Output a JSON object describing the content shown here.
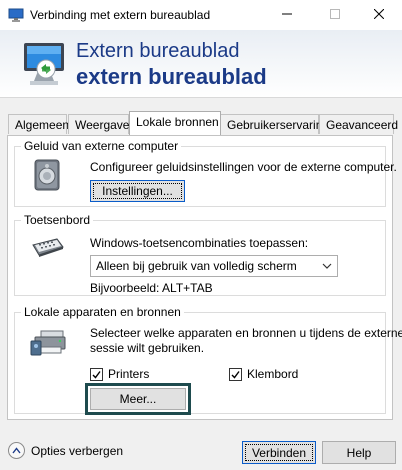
{
  "window": {
    "title": "Verbinding met extern bureaublad",
    "icons": [
      "remote-desktop-icon",
      "minimize-icon",
      "maximize-icon",
      "close-icon"
    ]
  },
  "header": {
    "line1": "Extern bureaublad",
    "line2": "extern bureaublad",
    "accent_color": "#1b3a87"
  },
  "tabs": [
    {
      "label": "Algemeen"
    },
    {
      "label": "Weergave"
    },
    {
      "label": "Lokale bronnen",
      "active": true
    },
    {
      "label": "Gebruikerservaring"
    },
    {
      "label": "Geavanceerd"
    }
  ],
  "sound": {
    "legend": "Geluid van externe computer",
    "description": "Configureer geluidsinstellingen voor de externe computer.",
    "button": "Instellingen..."
  },
  "keyboard": {
    "legend": "Toetsenbord",
    "description": "Windows-toetsencombinaties toepassen:",
    "selected": "Alleen bij gebruik van volledig scherm",
    "example": "Bijvoorbeeld: ALT+TAB"
  },
  "devices": {
    "legend": "Lokale apparaten en bronnen",
    "description_line1": "Selecteer welke apparaten en bronnen u tijdens de externe",
    "description_line2": "sessie wilt gebruiken.",
    "printers_label": "Printers",
    "printers_checked": true,
    "clipboard_label": "Klembord",
    "clipboard_checked": true,
    "more_button": "Meer..."
  },
  "footer": {
    "options_toggle": "Opties verbergen",
    "connect_button": "Verbinden",
    "help_button": "Help"
  }
}
